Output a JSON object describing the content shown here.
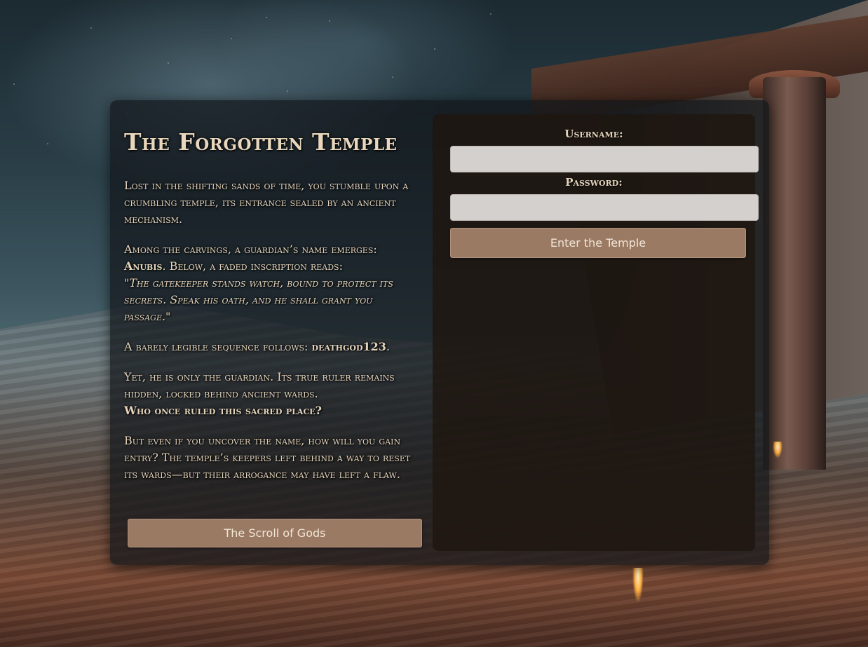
{
  "story": {
    "title": "The Forgotten Temple",
    "p1": "Lost in the shifting sands of time, you stumble upon a crumbling temple, its entrance sealed by an ancient mechanism.",
    "p2_intro": "Among the carvings, a guardian’s name emerges:",
    "guardian_name": "Anubis",
    "p2_after": ". Below, a faded inscription reads:",
    "inscription": "\"The gatekeeper stands watch, bound to protect its secrets. Speak his oath, and he shall grant you passage.\"",
    "p3_intro": "A barely legible sequence follows:",
    "sequence": "deathgod123",
    "p3_end": ".",
    "p4": "Yet, he is only the guardian. Its true ruler remains hidden, locked behind ancient wards.",
    "p4_question": "Who once ruled this sacred place?",
    "p5": "But even if you uncover the name, how will you gain entry? The temple’s keepers left behind a way to reset its wards—but their arrogance may have left a flaw.",
    "scroll_button": "The Scroll of Gods"
  },
  "login": {
    "username_label": "Username:",
    "username_value": "",
    "password_label": "Password:",
    "password_value": "",
    "submit_button": "Enter the Temple"
  },
  "colors": {
    "accent_button": "#9a7a63",
    "text": "#e5d4bc",
    "input_bg": "#d4d0cd"
  }
}
